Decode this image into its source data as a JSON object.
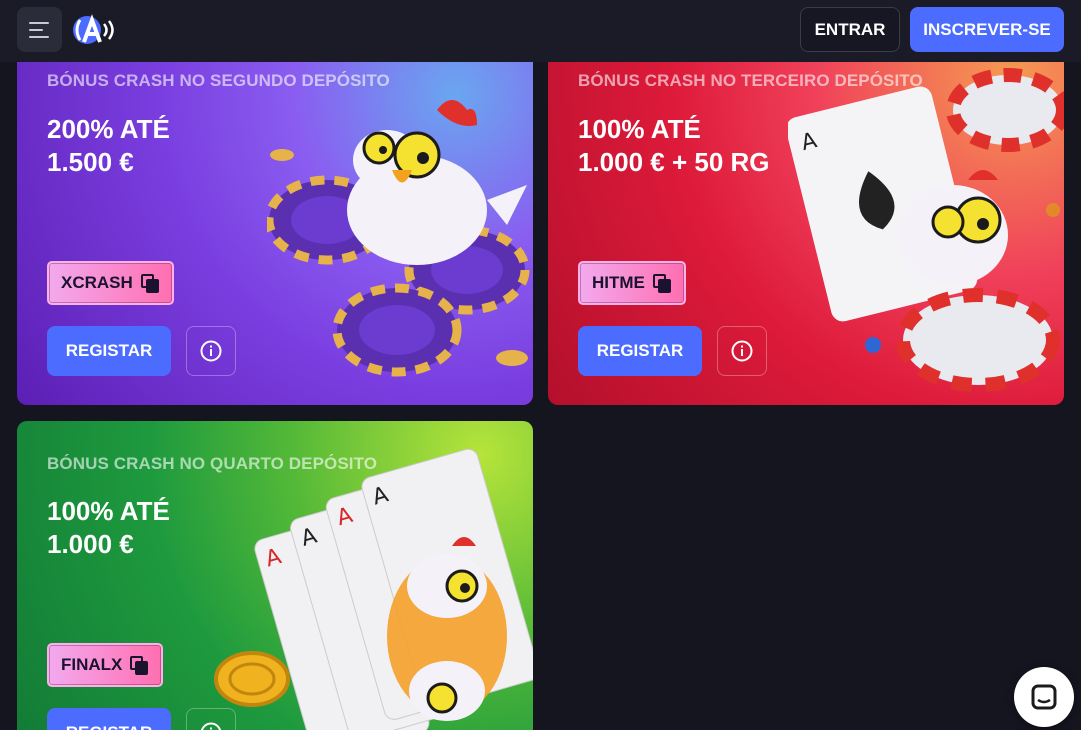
{
  "header": {
    "login_label": "ENTRAR",
    "signup_label": "INSCREVER-SE",
    "menu_icon": "hamburger-menu-icon",
    "logo": "brand-logo-icon"
  },
  "promos": [
    {
      "kicker": "BÓNUS CRASH NO SEGUNDO DEPÓSITO",
      "title": "200% ATÉ\n1.500 €",
      "code": "XCRASH",
      "register_label": "REGISTAR",
      "theme": "#7a3ee0"
    },
    {
      "kicker": "BÓNUS CRASH NO TERCEIRO DEPÓSITO",
      "title": "100% ATÉ\n1.000 € + 50 RG",
      "code": "HITME",
      "register_label": "REGISTAR",
      "theme": "#dd1a3a"
    },
    {
      "kicker": "BÓNUS CRASH NO QUARTO DEPÓSITO",
      "title": "100% ATÉ\n1.000 €",
      "code": "FINALX",
      "register_label": "REGISTAR",
      "theme": "#1e9a3e"
    }
  ],
  "colors": {
    "accent": "#4b6cff",
    "background": "#14151f",
    "header": "#1a1b27",
    "code_chip": "#ff6fb0"
  },
  "chat": {
    "icon": "chat-support-icon"
  }
}
